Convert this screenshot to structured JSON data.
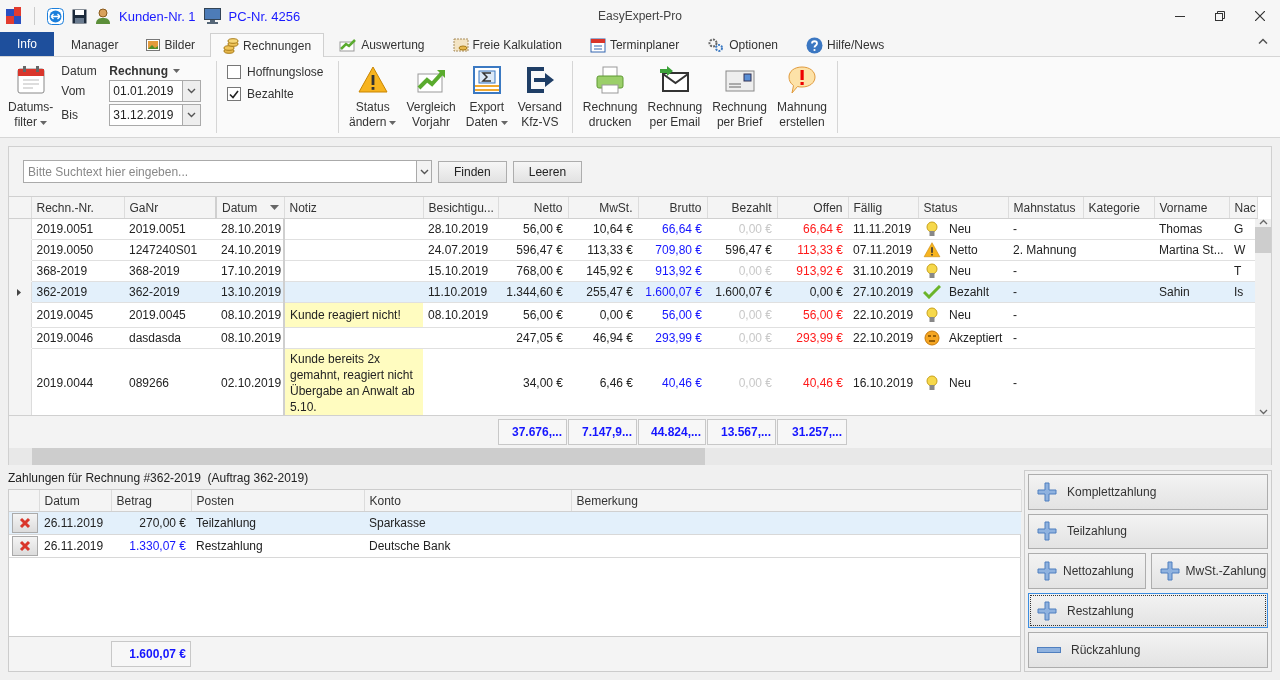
{
  "titlebar": {
    "customer": "Kunden-Nr. 1",
    "pc": "PC-Nr. 4256",
    "title": "EasyExpert-Pro"
  },
  "tabs": [
    {
      "label": "Info",
      "kind": "app",
      "selected": false
    },
    {
      "label": "Manager",
      "kind": "tab",
      "selected": false
    },
    {
      "label": "Bilder",
      "kind": "tab",
      "selected": false
    },
    {
      "label": "Rechnungen",
      "kind": "tab",
      "selected": true
    },
    {
      "label": "Auswertung",
      "kind": "tab",
      "selected": false
    },
    {
      "label": "Freie Kalkulation",
      "kind": "tab",
      "selected": false
    },
    {
      "label": "Terminplaner",
      "kind": "tab",
      "selected": false
    },
    {
      "label": "Optionen",
      "kind": "tab",
      "selected": false
    },
    {
      "label": "Hilfe/News",
      "kind": "tab",
      "selected": false
    }
  ],
  "ribbon": {
    "date_filter": {
      "button": [
        "Datums-",
        "filter"
      ],
      "dropdown": true,
      "date_label": "Datum",
      "date_type": "Rechnung",
      "from_label": "Vom",
      "from": "01.01.2019",
      "to_label": "Bis",
      "to": "31.12.2019"
    },
    "checkboxes": [
      {
        "label": "Hoffnungslose",
        "checked": false
      },
      {
        "label": "Bezahlte",
        "checked": true
      }
    ],
    "groups": [
      [
        {
          "lines": [
            "Status",
            "ändern"
          ],
          "dropdown": true
        },
        {
          "lines": [
            "Vergleich",
            "Vorjahr"
          ],
          "dropdown": false
        },
        {
          "lines": [
            "Export",
            "Daten"
          ],
          "dropdown": true
        },
        {
          "lines": [
            "Versand",
            "Kfz-VS"
          ],
          "dropdown": false
        }
      ],
      [
        {
          "lines": [
            "Rechnung",
            "drucken"
          ],
          "dropdown": false
        },
        {
          "lines": [
            "Rechnung",
            "per Email"
          ],
          "dropdown": false
        },
        {
          "lines": [
            "Rechnung",
            "per Brief"
          ],
          "dropdown": false
        },
        {
          "lines": [
            "Mahnung",
            "erstellen"
          ],
          "dropdown": false
        }
      ]
    ]
  },
  "search": {
    "placeholder": "Bitte Suchtext hier eingeben...",
    "buttons": [
      "Finden",
      "Leeren"
    ]
  },
  "table": {
    "columns": [
      {
        "label": "Rechn.-Nr.",
        "sorted": false
      },
      {
        "label": "GaNr",
        "sorted": false
      },
      {
        "label": "Datum",
        "sorted": true
      },
      {
        "label": "Notiz",
        "sorted": false
      },
      {
        "label": "Besichtigu...",
        "sorted": false
      },
      {
        "label": "Netto",
        "sorted": false
      },
      {
        "label": "MwSt.",
        "sorted": false
      },
      {
        "label": "Brutto",
        "sorted": false
      },
      {
        "label": "Bezahlt",
        "sorted": false
      },
      {
        "label": "Offen",
        "sorted": false
      },
      {
        "label": "Fällig",
        "sorted": false
      },
      {
        "label": "Status",
        "sorted": false
      },
      {
        "label": "Mahnstatus",
        "sorted": false
      },
      {
        "label": "Kategorie",
        "sorted": false
      },
      {
        "label": "Vorname",
        "sorted": false
      },
      {
        "label": "Nac",
        "sorted": false
      }
    ],
    "rows": [
      {
        "nr": "2019.0051",
        "ganr": "2019.0051",
        "datum": "28.10.2019",
        "besichtigung": "28.10.2019",
        "netto": "56,00 €",
        "mwst": "10,64 €",
        "brutto": "66,64 €",
        "bezahlt": "0,00 €",
        "offen": "66,64 €",
        "faellig": "11.11.2019",
        "status": {
          "kind": "new",
          "label": "Neu"
        },
        "mahnstatus": "-",
        "vorname": "Thomas",
        "nachname": "G",
        "selected": false,
        "payment_received": false,
        "paid": false
      },
      {
        "nr": "2019.0050",
        "ganr": "1247240S01",
        "datum": "24.10.2019",
        "besichtigung": "24.07.2019",
        "netto": "596,47 €",
        "mwst": "113,33 €",
        "brutto": "709,80 €",
        "bezahlt": "596,47 €",
        "offen": "113,33 €",
        "faellig": "07.11.2019",
        "status": {
          "kind": "warning",
          "label": "Netto"
        },
        "mahnstatus": "2. Mahnung",
        "vorname": "Martina St...",
        "nachname": "W",
        "selected": false,
        "payment_received": true,
        "paid": false
      },
      {
        "nr": "368-2019",
        "ganr": "368-2019",
        "datum": "17.10.2019",
        "besichtigung": "15.10.2019",
        "netto": "768,00 €",
        "mwst": "145,92 €",
        "brutto": "913,92 €",
        "bezahlt": "0,00 €",
        "offen": "913,92 €",
        "faellig": "31.10.2019",
        "status": {
          "kind": "new",
          "label": "Neu"
        },
        "mahnstatus": "-",
        "nachname": "T",
        "selected": false,
        "payment_received": false,
        "paid": false
      },
      {
        "nr": "362-2019",
        "ganr": "362-2019",
        "datum": "13.10.2019",
        "besichtigung": "11.10.2019",
        "netto": "1.344,60 €",
        "mwst": "255,47 €",
        "brutto": "1.600,07 €",
        "bezahlt": "1.600,07 €",
        "offen": "0,00 €",
        "faellig": "27.10.2019",
        "status": {
          "kind": "paid",
          "label": "Bezahlt"
        },
        "mahnstatus": "-",
        "vorname": "Sahin",
        "nachname": "Is",
        "selected": true,
        "payment_received": true,
        "paid": true
      },
      {
        "nr": "2019.0045",
        "ganr": "2019.0045",
        "datum": "08.10.2019",
        "notiz": "Kunde reagiert nicht!",
        "besichtigung": "08.10.2019",
        "netto": "56,00 €",
        "mwst": "0,00 €",
        "brutto": "56,00 €",
        "bezahlt": "0,00 €",
        "offen": "56,00 €",
        "faellig": "22.10.2019",
        "status": {
          "kind": "new",
          "label": "Neu"
        },
        "mahnstatus": "-",
        "selected": false,
        "payment_received": false,
        "paid": false
      },
      {
        "nr": "2019.0046",
        "ganr": "dasdasda",
        "datum": "08.10.2019",
        "netto": "247,05 €",
        "mwst": "46,94 €",
        "brutto": "293,99 €",
        "bezahlt": "0,00 €",
        "offen": "293,99 €",
        "faellig": "22.10.2019",
        "status": {
          "kind": "accepted",
          "label": "Akzeptiert"
        },
        "mahnstatus": "-",
        "selected": false,
        "payment_received": false,
        "paid": false
      },
      {
        "nr": "2019.0044",
        "ganr": "089266",
        "datum": "02.10.2019",
        "notiz": "Kunde bereits 2x gemahnt, reagiert nicht Übergabe an Anwalt ab 5.10.",
        "netto": "34,00 €",
        "mwst": "6,46 €",
        "brutto": "40,46 €",
        "bezahlt": "0,00 €",
        "offen": "40,46 €",
        "faellig": "16.10.2019",
        "status": {
          "kind": "new",
          "label": "Neu"
        },
        "mahnstatus": "-",
        "selected": false,
        "payment_received": false,
        "paid": false
      }
    ],
    "totals": [
      "37.676,...",
      "7.147,9...",
      "44.824,...",
      "13.567,...",
      "31.257,..."
    ]
  },
  "payments": {
    "title": "Zahlungen für Rechnung #362-2019  (Auftrag 362-2019)",
    "columns": [
      "Datum",
      "Betrag",
      "Posten",
      "Konto",
      "Bemerkung"
    ],
    "rows": [
      {
        "datum": "26.11.2019",
        "betrag": "270,00 €",
        "posten": "Teilzahlung",
        "konto": "Sparkasse",
        "selected": true,
        "highlight": false
      },
      {
        "datum": "26.11.2019",
        "betrag": "1.330,07 €",
        "posten": "Restzahlung",
        "konto": "Deutsche Bank",
        "selected": false,
        "highlight": true
      }
    ],
    "total": "1.600,07 €"
  },
  "actions": [
    [
      {
        "label": "Komplettzahlung",
        "kind": "add",
        "focused": false
      }
    ],
    [
      {
        "label": "Teilzahlung",
        "kind": "add",
        "focused": false
      }
    ],
    [
      {
        "label": "Nettozahlung",
        "kind": "add",
        "focused": false
      },
      {
        "label": "MwSt.-Zahlung",
        "kind": "add",
        "focused": false
      }
    ],
    [
      {
        "label": "Restzahlung",
        "kind": "add",
        "focused": true
      }
    ],
    [
      {
        "label": "Rückzahlung",
        "kind": "remove",
        "focused": false
      }
    ]
  ]
}
